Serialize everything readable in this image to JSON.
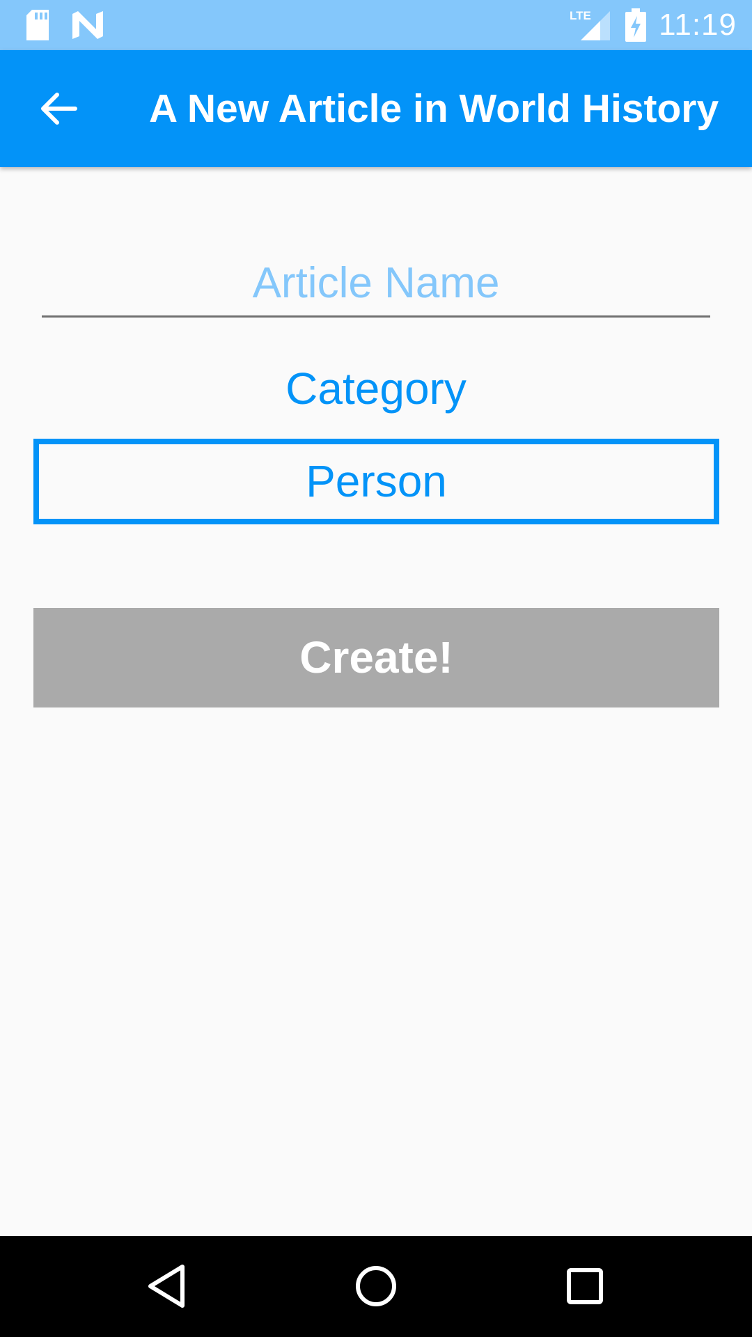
{
  "status_bar": {
    "time": "11:19",
    "network": "LTE",
    "icons": [
      "sd-card-icon",
      "n-notification-icon",
      "lte-signal-icon",
      "battery-charging-icon"
    ]
  },
  "app_bar": {
    "title": "A New Article in World History",
    "back_icon": "arrow-left-icon",
    "color": "#0393F8"
  },
  "form": {
    "article_name": {
      "placeholder": "Article Name",
      "value": ""
    },
    "category": {
      "label": "Category",
      "selected": "Person"
    },
    "create_button": {
      "label": "Create!",
      "color": "#AAAAAA",
      "enabled": false
    }
  },
  "nav_bar": {
    "icons": [
      "back-triangle-icon",
      "home-circle-icon",
      "recents-square-icon"
    ]
  },
  "colors": {
    "accent": "#0393F8",
    "status_bar": "#84C7FB",
    "placeholder": "#84C7FB",
    "background": "#FAFAFA"
  }
}
